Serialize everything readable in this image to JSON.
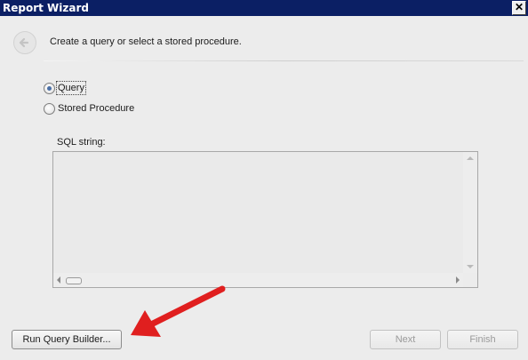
{
  "window": {
    "title": "Report Wizard",
    "close_label": "✕"
  },
  "header": {
    "instruction": "Create a query or select a stored procedure."
  },
  "options": {
    "query_label": "Query",
    "stored_procedure_label": "Stored Procedure",
    "selected": "Query"
  },
  "sql": {
    "label": "SQL string:",
    "value": ""
  },
  "buttons": {
    "run_query_builder": "Run Query Builder...",
    "next": "Next",
    "finish": "Finish"
  },
  "colors": {
    "titlebar": "#0b1f64",
    "annotation_arrow": "#e01f1f"
  },
  "icons": {
    "back": "arrow-left-icon"
  }
}
